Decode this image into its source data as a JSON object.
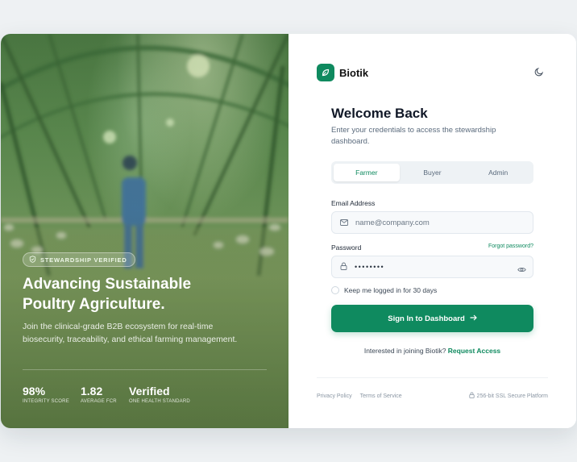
{
  "hero": {
    "badge": "STEWARDSHIP VERIFIED",
    "headline_line1": "Advancing Sustainable",
    "headline_line2": "Poultry Agriculture.",
    "description": "Join the clinical-grade B2B ecosystem for real-time biosecurity, traceability, and ethical farming management.",
    "stats": [
      {
        "value": "98%",
        "label": "INTEGRITY SCORE"
      },
      {
        "value": "1.82",
        "label": "AVERAGE FCR"
      },
      {
        "value": "Verified",
        "label": "ONE HEALTH STANDARD"
      }
    ]
  },
  "brand": {
    "name": "Biotik",
    "accent": "#0f8a5f"
  },
  "login": {
    "title": "Welcome Back",
    "subtitle": "Enter your credentials to access the stewardship dashboard.",
    "tabs": [
      {
        "label": "Farmer",
        "active": true
      },
      {
        "label": "Buyer",
        "active": false
      },
      {
        "label": "Admin",
        "active": false
      }
    ],
    "email_label": "Email Address",
    "email_placeholder": "name@company.com",
    "password_label": "Password",
    "forgot_label": "Forgot password?",
    "password_value": "••••••••",
    "remember_label": "Keep me logged in for 30 days",
    "submit_label": "Sign In to Dashboard",
    "join_text": "Interested in joining Biotik?",
    "join_link": "Request Access"
  },
  "footer": {
    "privacy": "Privacy Policy",
    "terms": "Terms of Service",
    "ssl": "256-bit SSL Secure Platform"
  },
  "icons": {
    "logo": "leaf-icon",
    "theme": "moon-icon",
    "email": "mail-icon",
    "password": "lock-icon",
    "reveal": "eye-icon",
    "submit": "arrow-right-icon",
    "badge": "shield-check-icon",
    "ssl": "lock-icon"
  }
}
